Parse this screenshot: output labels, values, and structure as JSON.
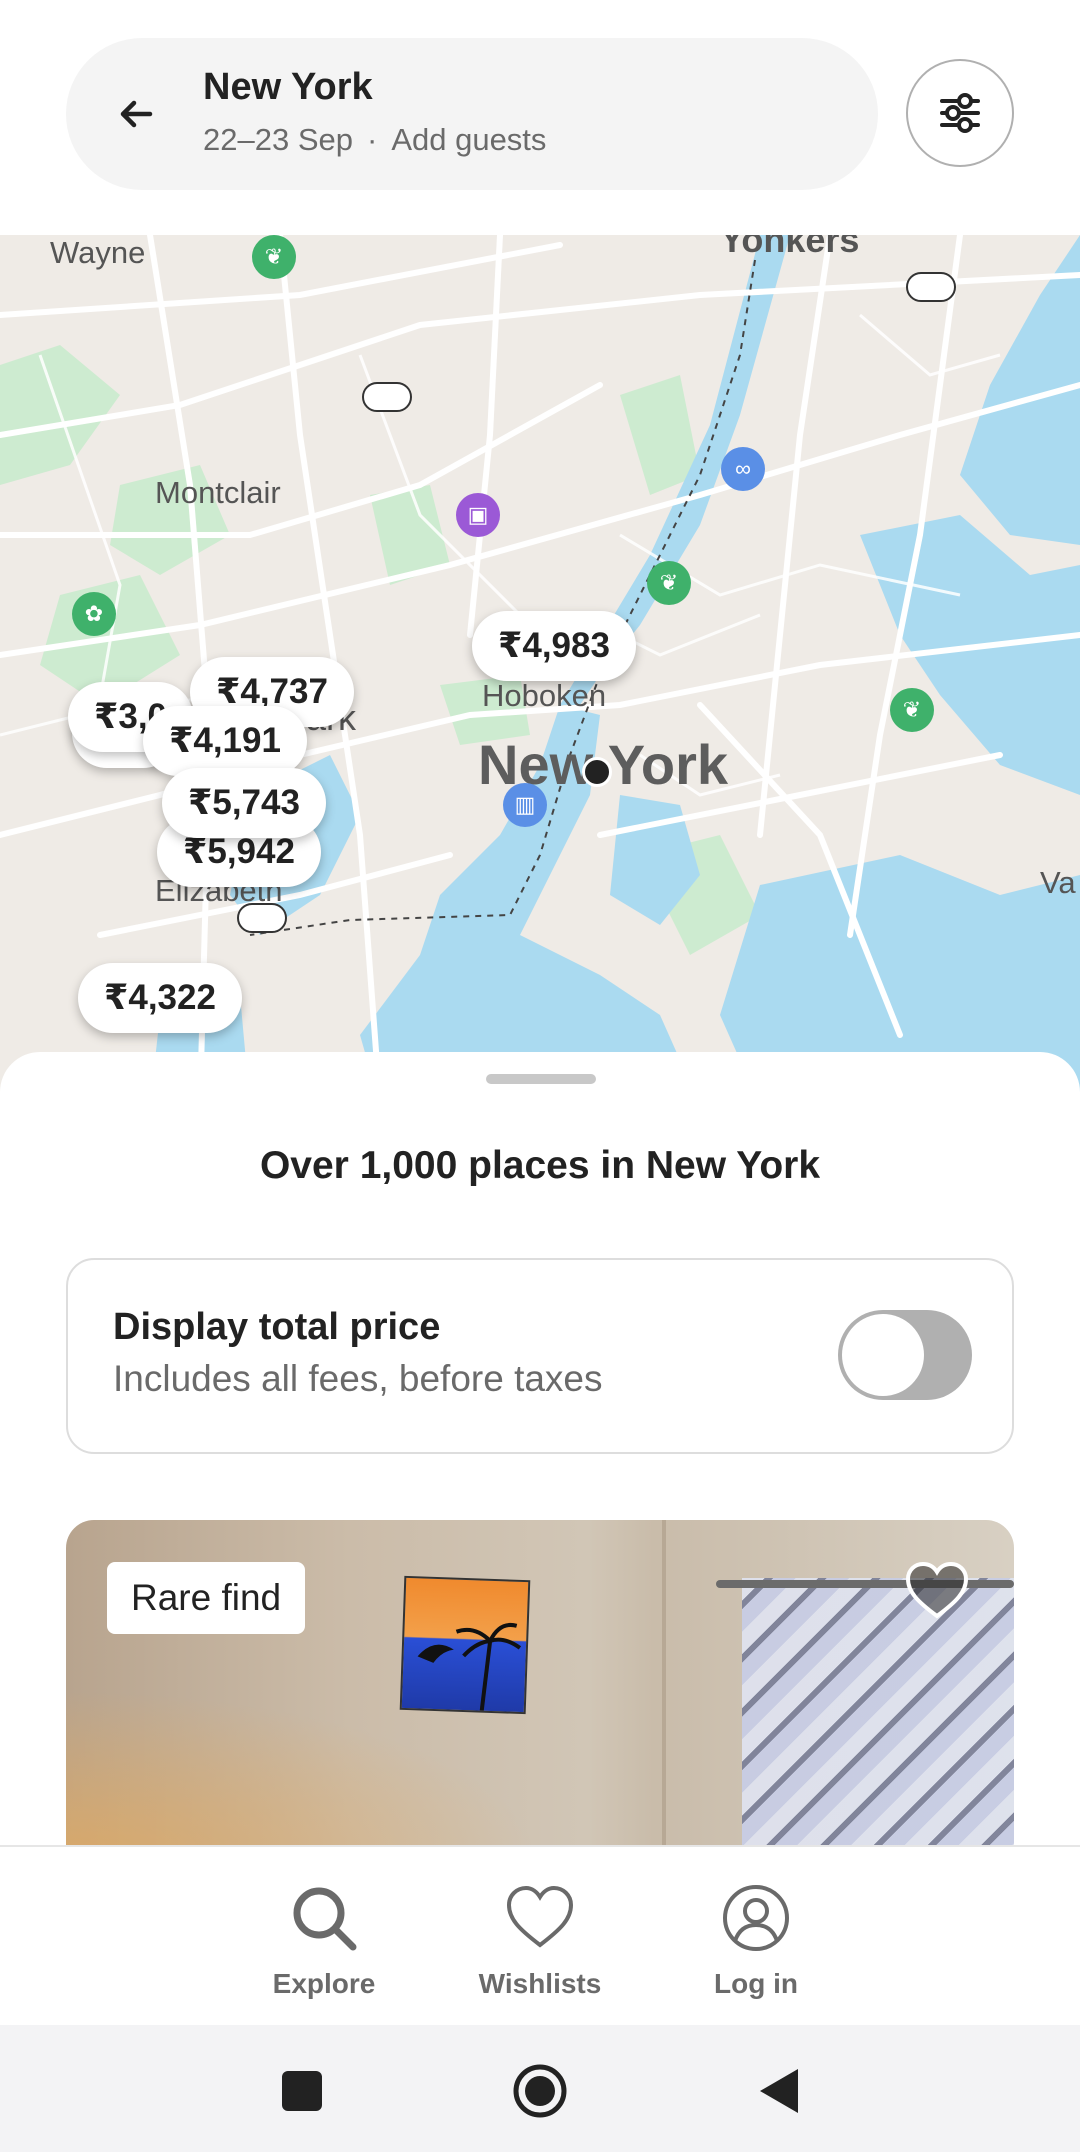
{
  "search": {
    "destination": "New York",
    "dates": "22–23 Sep",
    "guests": "Add guests",
    "separator": "·"
  },
  "map": {
    "labels": {
      "wayne": "Wayne",
      "yonkers": "Yonkers",
      "montclair": "Montclair",
      "hoboken": "Hoboken",
      "new_york": "New York",
      "elizabeth": "Elizabeth",
      "newark_partial": "ark",
      "va_partial": "Va"
    },
    "price_pins": [
      "₹4,983",
      "₹4,737",
      "₹3,0",
      "₹3,",
      "₹4,191",
      "4",
      "₹5,743",
      "₹5,942",
      "₹4,322"
    ],
    "poi_icons": [
      "park-icon",
      "shopping-icon",
      "binoculars-icon",
      "park-icon",
      "park-icon",
      "paw-icon",
      "museum-icon"
    ]
  },
  "sheet": {
    "results_title": "Over 1,000 places in New York",
    "total_price": {
      "title": "Display total price",
      "subtitle": "Includes all fees, before taxes",
      "toggle_on": false
    },
    "listing": {
      "badge": "Rare find"
    }
  },
  "bottom_nav": {
    "items": [
      {
        "label": "Explore",
        "icon": "search-icon"
      },
      {
        "label": "Wishlists",
        "icon": "heart-icon"
      },
      {
        "label": "Log in",
        "icon": "user-circle-icon"
      }
    ]
  },
  "system_nav": [
    "recents-button",
    "home-button",
    "back-button"
  ],
  "colors": {
    "water": "#aadaf0",
    "park": "#cdebd0",
    "map_bg": "#efebe6",
    "toggle_off": "#b0b0b0",
    "text_primary": "#222222",
    "text_secondary": "#6a6a6a"
  }
}
